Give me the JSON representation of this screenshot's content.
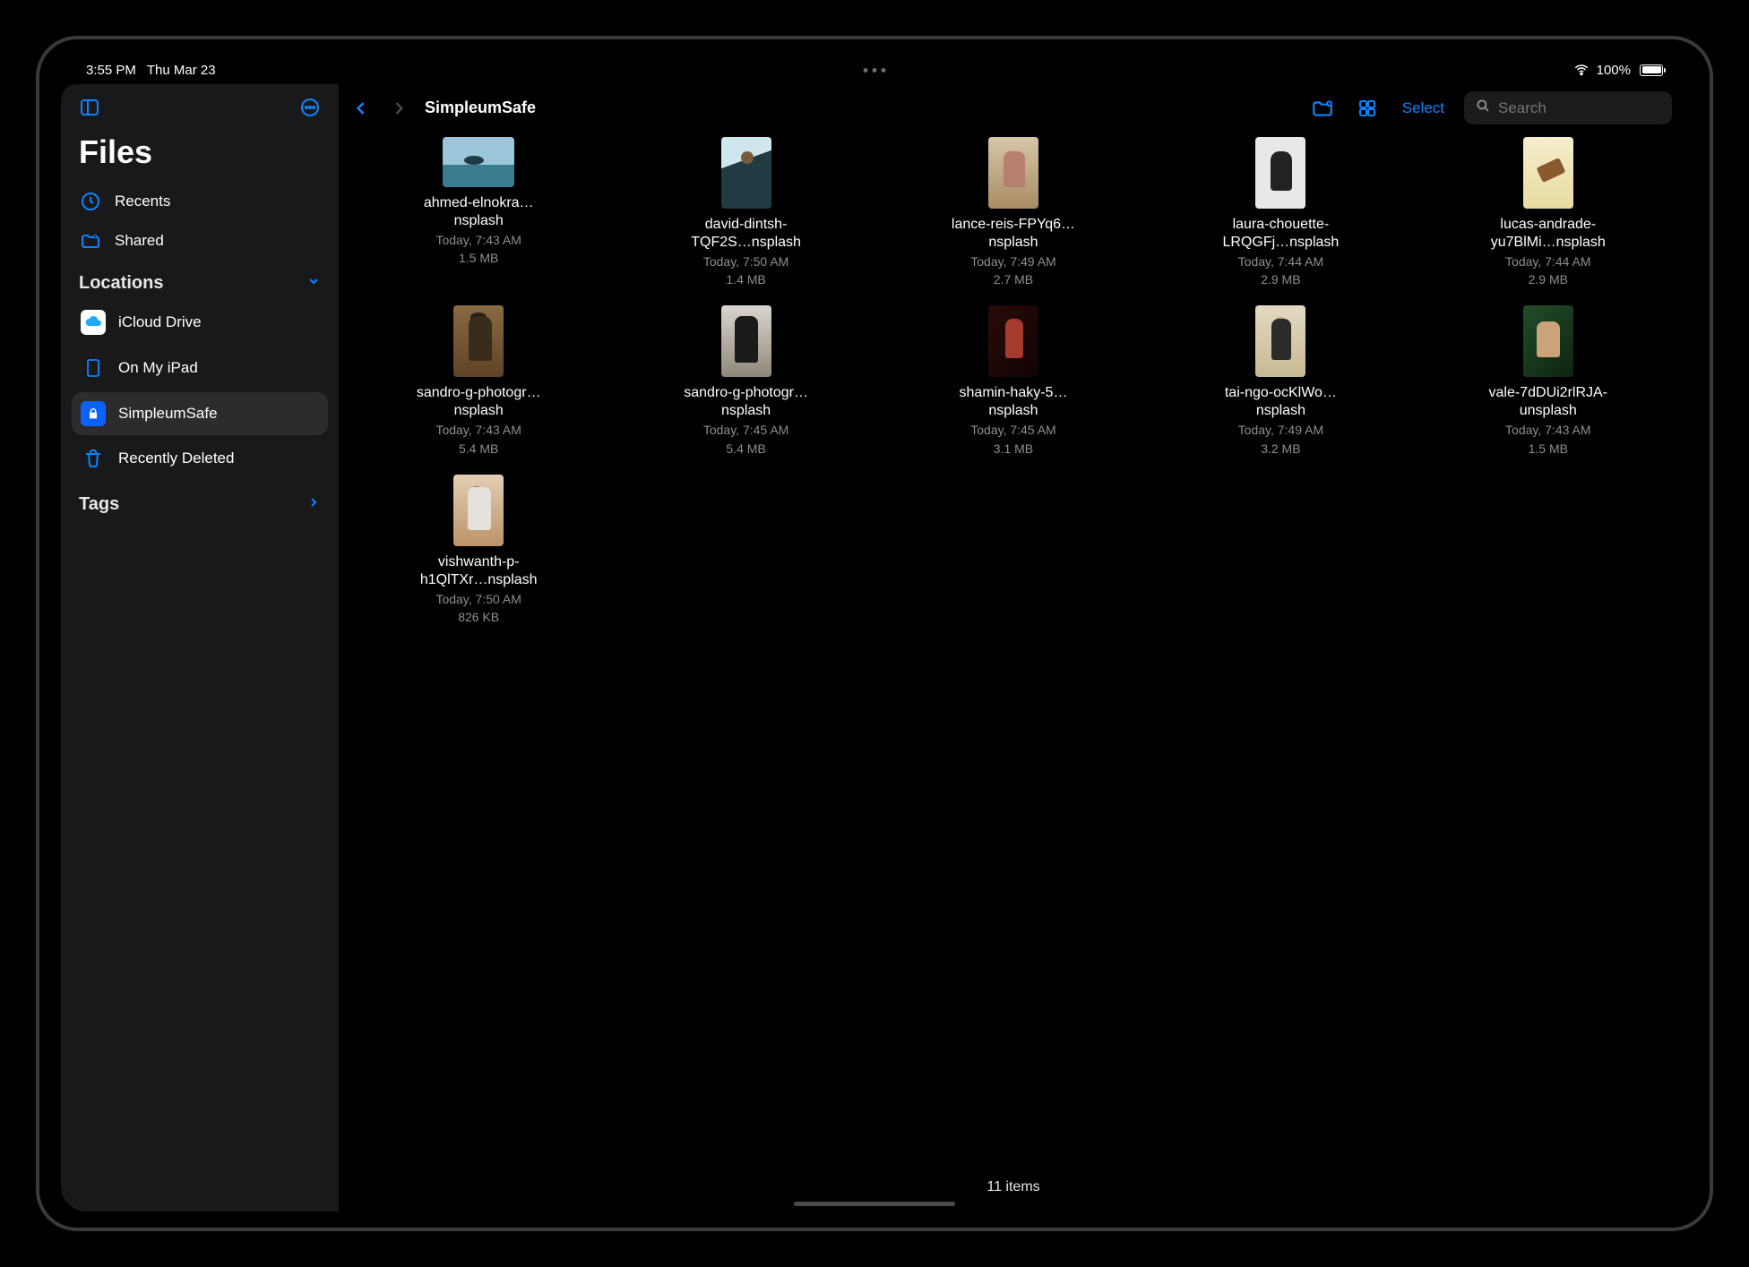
{
  "status": {
    "time": "3:55 PM",
    "date": "Thu Mar 23",
    "battery": "100%"
  },
  "sidebar": {
    "title": "Files",
    "recents": "Recents",
    "shared": "Shared",
    "sections": {
      "locations_label": "Locations",
      "tags_label": "Tags"
    },
    "locations": [
      {
        "label": "iCloud Drive"
      },
      {
        "label": "On My iPad"
      },
      {
        "label": "SimpleumSafe"
      },
      {
        "label": "Recently Deleted"
      }
    ]
  },
  "toolbar": {
    "title": "SimpleumSafe",
    "select_label": "Select",
    "search_placeholder": "Search"
  },
  "files": [
    {
      "name": "ahmed-elnokra…nsplash",
      "time": "Today, 7:43 AM",
      "size": "1.5 MB",
      "orient": "landscape",
      "ph": "ph1"
    },
    {
      "name": "david-dintsh-TQF2S…nsplash",
      "time": "Today, 7:50 AM",
      "size": "1.4 MB",
      "orient": "portrait",
      "ph": "ph2"
    },
    {
      "name": "lance-reis-FPYq6…nsplash",
      "time": "Today, 7:49 AM",
      "size": "2.7 MB",
      "orient": "portrait",
      "ph": "ph3"
    },
    {
      "name": "laura-chouette-LRQGFj…nsplash",
      "time": "Today, 7:44 AM",
      "size": "2.9 MB",
      "orient": "portrait",
      "ph": "ph4"
    },
    {
      "name": "lucas-andrade-yu7BlMi…nsplash",
      "time": "Today, 7:44 AM",
      "size": "2.9 MB",
      "orient": "portrait",
      "ph": "ph5"
    },
    {
      "name": "sandro-g-photogr…nsplash",
      "time": "Today, 7:43 AM",
      "size": "5.4 MB",
      "orient": "portrait",
      "ph": "ph6"
    },
    {
      "name": "sandro-g-photogr…nsplash",
      "time": "Today, 7:45 AM",
      "size": "5.4 MB",
      "orient": "portrait",
      "ph": "ph7"
    },
    {
      "name": "shamin-haky-5…nsplash",
      "time": "Today, 7:45 AM",
      "size": "3.1 MB",
      "orient": "portrait",
      "ph": "ph8"
    },
    {
      "name": "tai-ngo-ocKlWo…nsplash",
      "time": "Today, 7:49 AM",
      "size": "3.2 MB",
      "orient": "portrait",
      "ph": "ph9"
    },
    {
      "name": "vale-7dDUi2rlRJA-unsplash",
      "time": "Today, 7:43 AM",
      "size": "1.5 MB",
      "orient": "portrait",
      "ph": "ph10"
    },
    {
      "name": "vishwanth-p-h1QlTXr…nsplash",
      "time": "Today, 7:50 AM",
      "size": "826 KB",
      "orient": "portrait",
      "ph": "ph11"
    }
  ],
  "footer": {
    "count_label": "11 items"
  }
}
